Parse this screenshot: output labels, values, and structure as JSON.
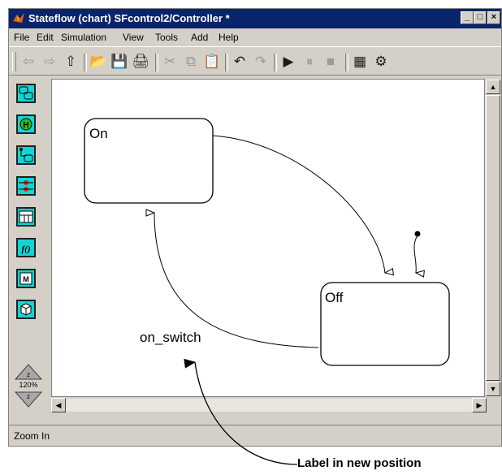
{
  "window": {
    "title": "Stateflow (chart) SFcontrol2/Controller *",
    "buttons": {
      "minimize": "_",
      "maximize": "□",
      "close": "×"
    }
  },
  "menu": [
    "File",
    "Edit",
    "Simulation",
    "View",
    "Tools",
    "Add",
    "Help"
  ],
  "toolbar": [
    {
      "name": "back-icon",
      "glyph": "⇦",
      "enabled": false
    },
    {
      "name": "forward-icon",
      "glyph": "⇨",
      "enabled": false
    },
    {
      "name": "up-icon",
      "glyph": "⇧",
      "enabled": true
    },
    {
      "name": "open-icon",
      "glyph": "📂",
      "enabled": true
    },
    {
      "name": "save-icon",
      "glyph": "💾",
      "enabled": true
    },
    {
      "name": "print-icon",
      "glyph": "🖨",
      "enabled": true
    },
    {
      "name": "cut-icon",
      "glyph": "✂",
      "enabled": false
    },
    {
      "name": "copy-icon",
      "glyph": "⧉",
      "enabled": false
    },
    {
      "name": "paste-icon",
      "glyph": "📋",
      "enabled": true
    },
    {
      "name": "undo-icon",
      "glyph": "↶",
      "enabled": true
    },
    {
      "name": "redo-icon",
      "glyph": "↷",
      "enabled": false
    },
    {
      "name": "start-icon",
      "glyph": "▶",
      "enabled": true
    },
    {
      "name": "pause-icon",
      "glyph": "⏸",
      "enabled": false
    },
    {
      "name": "stop-icon",
      "glyph": "■",
      "enabled": false
    },
    {
      "name": "explorer-icon",
      "glyph": "▦",
      "enabled": true
    },
    {
      "name": "debug-icon",
      "glyph": "⚙",
      "enabled": true
    }
  ],
  "palette": [
    {
      "name": "state-tool-icon"
    },
    {
      "name": "history-junction-tool-icon"
    },
    {
      "name": "default-transition-tool-icon"
    },
    {
      "name": "connective-junction-tool-icon"
    },
    {
      "name": "truth-table-tool-icon"
    },
    {
      "name": "graphical-function-tool-icon"
    },
    {
      "name": "embedded-matlab-tool-icon"
    },
    {
      "name": "box-tool-icon"
    }
  ],
  "palette_labels": {
    "history": "H",
    "function": "f()",
    "matlab": "M"
  },
  "zoom": {
    "level": "120%"
  },
  "chart": {
    "states": {
      "on": "On",
      "off": "Off"
    },
    "transition_label": "on_switch"
  },
  "status": {
    "text": "Zoom In"
  },
  "annotation": {
    "callout": "Label in new position"
  }
}
